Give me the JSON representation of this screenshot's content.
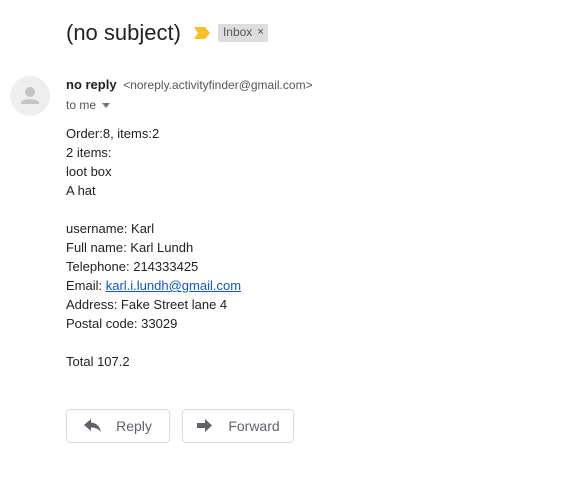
{
  "subject": "(no subject)",
  "label_chip": {
    "text": "Inbox",
    "remove": "×"
  },
  "colors": {
    "important_marker": "#f6c026",
    "link": "#1155cc",
    "chip_bg": "#dddddd"
  },
  "icons": {
    "important": "important-marker-icon",
    "avatar": "person-avatar-icon",
    "caret": "chevron-down-icon",
    "reply": "reply-arrow-icon",
    "forward": "forward-arrow-icon"
  },
  "sender": {
    "name": "no reply",
    "email": "<noreply.activityfinder@gmail.com>"
  },
  "recipient": {
    "to_label": "to me"
  },
  "body": {
    "lines": [
      "Order:8, items:2",
      "2 items:",
      "loot box",
      "A hat",
      "",
      "username: Karl",
      "Full name: Karl Lundh",
      "Telephone: 214333425"
    ],
    "email_label": "Email: ",
    "email_link": "karl.i.lundh@gmail.com",
    "lines_after": [
      "Address: Fake Street lane 4",
      "Postal code: 33029",
      "",
      "Total 107.2"
    ]
  },
  "actions": {
    "reply": "Reply",
    "forward": "Forward"
  }
}
